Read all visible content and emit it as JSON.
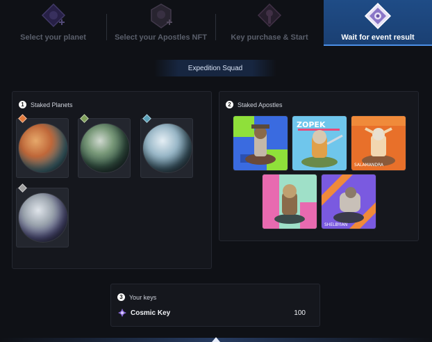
{
  "steps": [
    {
      "label": "Select your planet",
      "icon": "planet-step-icon",
      "active": false
    },
    {
      "label": "Select your Apostles NFT",
      "icon": "apostle-step-icon",
      "active": false
    },
    {
      "label": "Key purchase & Start",
      "icon": "key-step-icon",
      "active": false
    },
    {
      "label": "Wait for event result",
      "icon": "event-step-icon",
      "active": true
    }
  ],
  "squad": {
    "label": "Expedition Squad"
  },
  "staked_planets": {
    "number": "1",
    "title": "Staked Planets",
    "items": [
      {
        "name": "planet-1",
        "gem_color": "#e27a3c",
        "color_a": "#d77a3a",
        "color_b": "#3c6a78"
      },
      {
        "name": "planet-2",
        "gem_color": "#7fa05a",
        "color_a": "#5f8a6a",
        "color_b": "#2c3a52"
      },
      {
        "name": "planet-3",
        "gem_color": "#5aa0b8",
        "color_a": "#8ab7cc",
        "color_b": "#2c4050"
      },
      {
        "name": "planet-4",
        "gem_color": "#a0a0a0",
        "color_a": "#9aa3ad",
        "color_b": "#4a3a6a"
      }
    ]
  },
  "staked_apostles": {
    "number": "2",
    "title": "Staked Apostles",
    "items": [
      {
        "name": "apostle-1",
        "bg": "#3a6be0",
        "accent": "#8fe03a"
      },
      {
        "name": "apostle-2",
        "bg": "#6fc6ec",
        "accent": "#e84a7a"
      },
      {
        "name": "apostle-3",
        "bg": "#e8702a",
        "accent": "#f2d7b0"
      },
      {
        "name": "apostle-4",
        "bg": "#9fe0c8",
        "accent": "#e86ab0"
      },
      {
        "name": "apostle-5",
        "bg": "#7a5ae0",
        "accent": "#f08a3a"
      }
    ]
  },
  "keys": {
    "number": "3",
    "title": "Your keys",
    "name": "Cosmic Key",
    "count": "100",
    "icon": "cosmic-key-icon"
  }
}
